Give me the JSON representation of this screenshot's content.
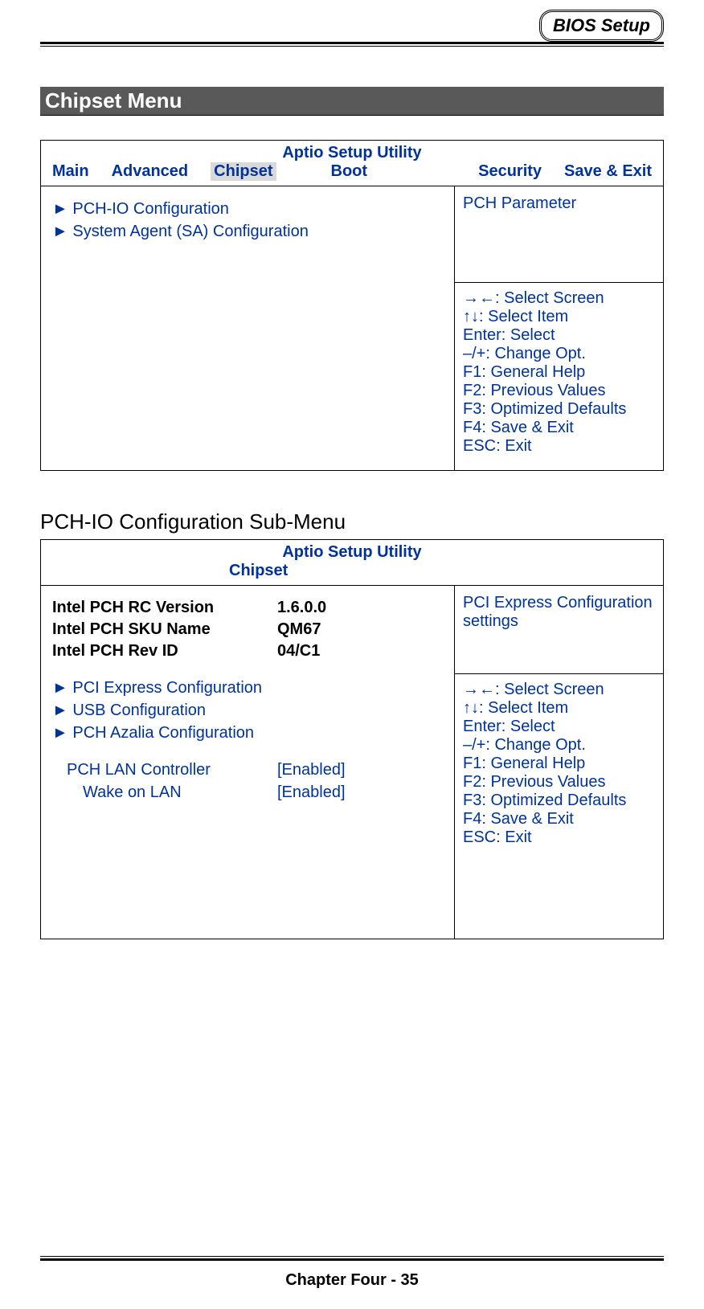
{
  "header": {
    "badge": "BIOS Setup"
  },
  "section1": {
    "title": "Chipset Menu",
    "bios_title": "Aptio Setup Utility",
    "tabs": [
      "Main",
      "Advanced",
      "Chipset",
      "Boot",
      "Security",
      "Save & Exit"
    ],
    "active_tab_index": 2,
    "menu_items": [
      "PCH-IO Configuration",
      "System Agent (SA) Configuration"
    ],
    "help_text": "PCH Parameter",
    "keys": [
      "→←: Select Screen",
      "↑↓: Select Item",
      "Enter: Select",
      "–/+: Change Opt.",
      "F1: General Help",
      "F2: Previous Values",
      "F3: Optimized Defaults",
      "F4: Save & Exit",
      "ESC: Exit"
    ]
  },
  "section2": {
    "title": "PCH-IO Configuration Sub-Menu",
    "bios_title": "Aptio Setup Utility",
    "tab": "Chipset",
    "info": [
      {
        "label": "Intel PCH RC Version",
        "value": "1.6.0.0"
      },
      {
        "label": "Intel PCH SKU Name",
        "value": "QM67"
      },
      {
        "label": "Intel PCH Rev ID",
        "value": "04/C1"
      }
    ],
    "menu_items": [
      "PCI Express Configuration",
      "USB Configuration",
      "PCH Azalia Configuration"
    ],
    "options": [
      {
        "label": "PCH LAN Controller",
        "value": "[Enabled]",
        "indent": 1
      },
      {
        "label": "Wake on LAN",
        "value": "[Enabled]",
        "indent": 2
      }
    ],
    "help_text": "PCI Express Configuration settings",
    "keys": [
      "→←: Select Screen",
      "↑↓: Select Item",
      "Enter: Select",
      "–/+: Change Opt.",
      "F1: General Help",
      "F2: Previous Values",
      "F3: Optimized Defaults",
      "F4: Save & Exit",
      "ESC: Exit"
    ]
  },
  "footer": {
    "text": "Chapter Four - 35"
  }
}
